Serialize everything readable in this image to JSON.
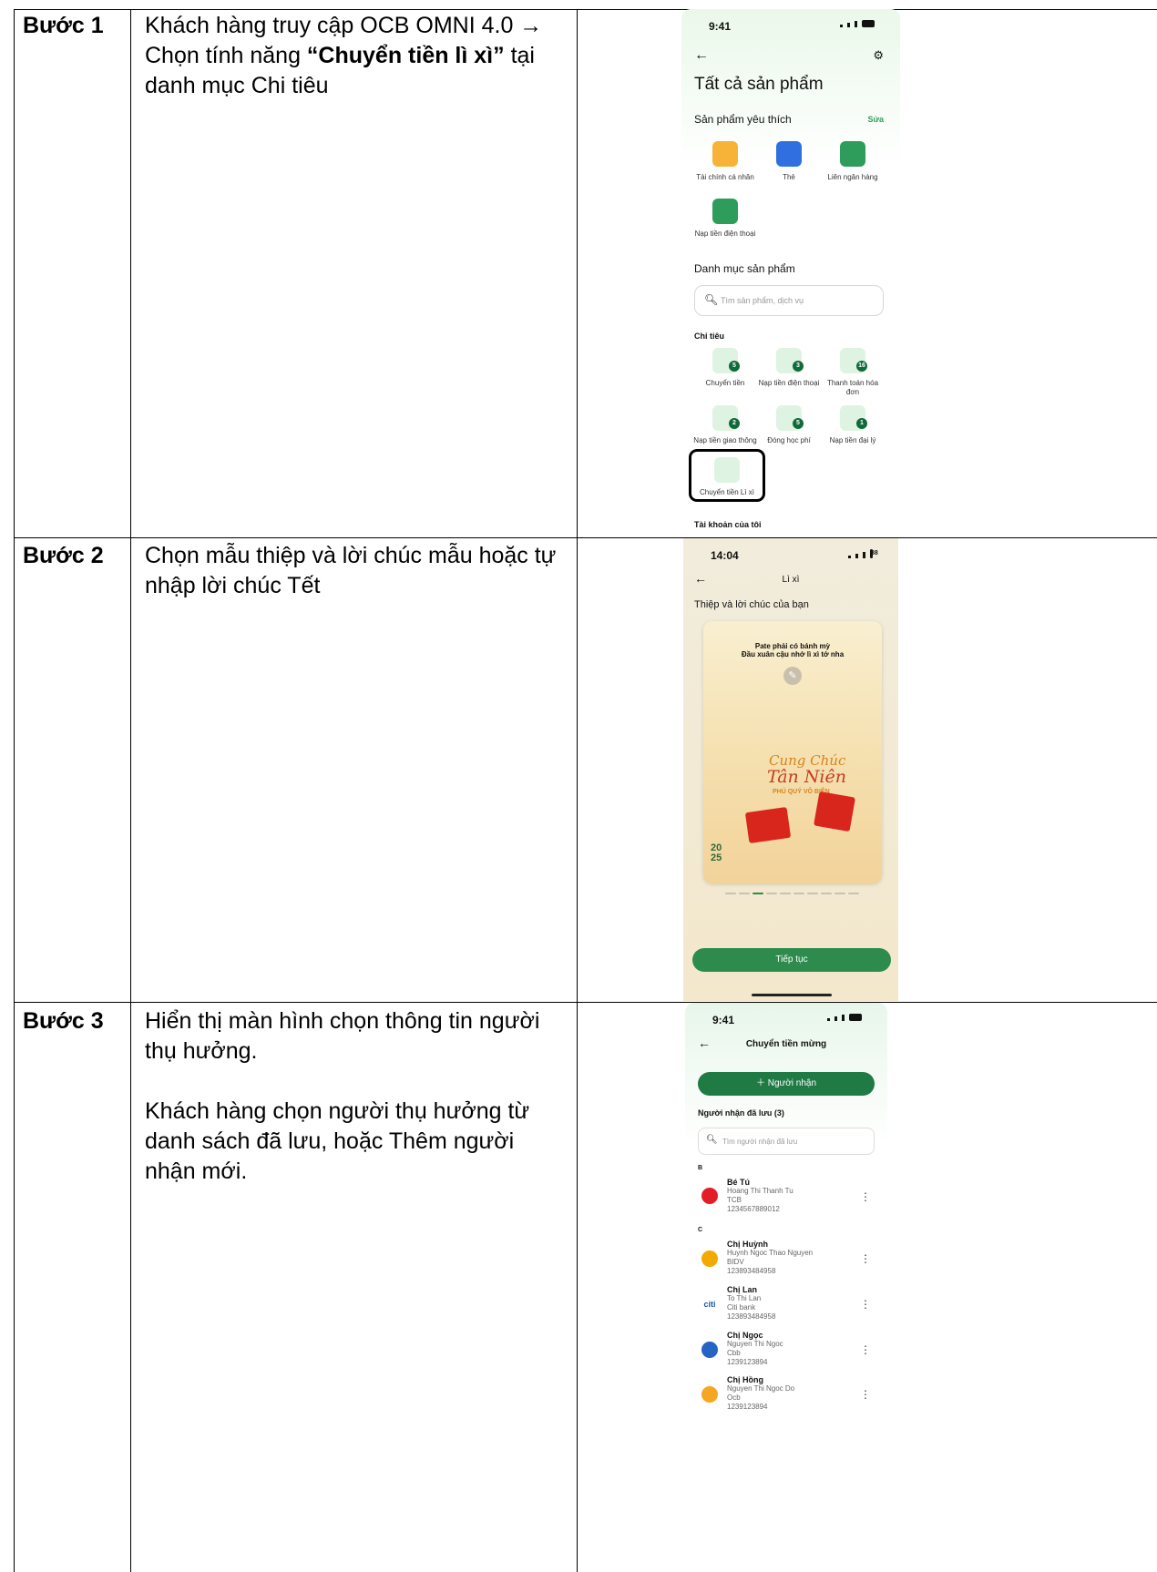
{
  "steps": [
    {
      "label": "Bước 1",
      "desc_pre": "Khách hàng truy cập OCB OMNI 4.0 → Chọn tính năng ",
      "desc_bold": "“Chuyển tiền lì xì”",
      "desc_post": " tại danh mục Chi tiêu"
    },
    {
      "label": "Bước 2",
      "desc": "Chọn mẫu thiệp và lời chúc mẫu hoặc tự nhập lời chúc Tết"
    },
    {
      "label": "Bước 3",
      "desc_p1": "Hiển thị màn hình chọn thông tin người thụ hưởng.",
      "desc_p2": "Khách hàng chọn người thụ hưởng từ danh sách đã lưu, hoặc Thêm người nhận mới."
    }
  ],
  "screen1": {
    "time": "9:41",
    "title": "Tất cả sản phẩm",
    "fav_title": "Sản phẩm yêu thích",
    "fav_edit": "Sửa",
    "favorites": [
      "Tài chính cá nhân",
      "Thẻ",
      "Liên ngân hàng",
      "Nạp tiền điện thoại"
    ],
    "catalog_title": "Danh mục sản phẩm",
    "search_placeholder": "Tìm sản phẩm, dịch vụ",
    "section": "Chi tiêu",
    "items": [
      {
        "label": "Chuyển tiền",
        "badge": "5"
      },
      {
        "label": "Nạp tiền điện thoại",
        "badge": "3"
      },
      {
        "label": "Thanh toán hóa đơn",
        "badge": "16"
      },
      {
        "label": "Nạp tiền giao thông",
        "badge": "2"
      },
      {
        "label": "Đóng học phí",
        "badge": "5"
      },
      {
        "label": "Nạp tiền đại lý",
        "badge": "1"
      }
    ],
    "highlight_label": "Chuyển tiền Lì xì",
    "bottom_section": "Tài khoản của tôi",
    "accent": "#2e9d5b"
  },
  "screen2": {
    "time": "14:04",
    "battery": "88",
    "title": "Lì xì",
    "subtitle": "Thiệp và lời chúc của bạn",
    "card_line1": "Pate phải có bánh mỳ",
    "card_line2": "Đầu xuân cậu nhớ lì xì tớ nha",
    "card_art1": "Cung Chúc",
    "card_art2": "Tân Niên",
    "card_art3": "PHÚ QUÝ VÔ BIÊN",
    "card_year": "2025",
    "pager_total": 10,
    "pager_active": 3,
    "continue": "Tiếp tục"
  },
  "screen3": {
    "time": "9:41",
    "title": "Chuyển tiền mừng",
    "add_button": "Người nhận",
    "saved_title": "Người nhận đã lưu (3)",
    "search_placeholder": "Tìm người nhận đã lưu",
    "groups": [
      {
        "letter": "B",
        "contacts": [
          {
            "name": "Bé Tú",
            "full": "Hoang Thi Thanh Tu",
            "bank": "TCB",
            "acct": "1234567889012",
            "color": "#e21f26"
          }
        ]
      },
      {
        "letter": "C",
        "contacts": [
          {
            "name": "Chị Huỳnh",
            "full": "Huynh Ngoc Thao Nguyen",
            "bank": "BIDV",
            "acct": "123893484958",
            "color": "#f2a900"
          },
          {
            "name": "Chị Lan",
            "full": "To Thi Lan",
            "bank": "Citi bank",
            "acct": "123893484958",
            "color": "#1a5aa6"
          },
          {
            "name": "Chị Ngọc",
            "full": "Nguyen Thi Ngoc",
            "bank": "Cbb",
            "acct": "1239123894",
            "color": "#2563c4"
          },
          {
            "name": "Chị Hồng",
            "full": "Nguyen Thi Ngoc Do",
            "bank": "Ocb",
            "acct": "1239123894",
            "color": "#f5a623"
          }
        ]
      }
    ]
  }
}
